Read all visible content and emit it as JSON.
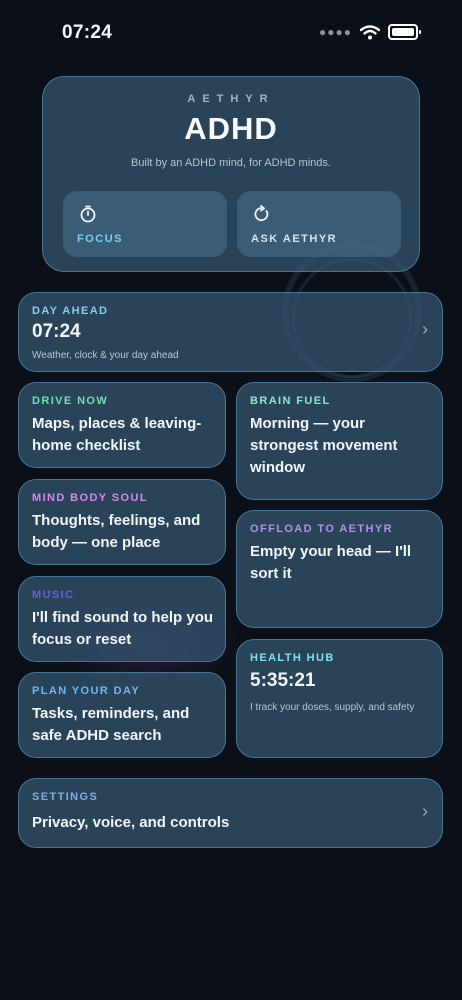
{
  "status_bar": {
    "time": "07:24"
  },
  "hero": {
    "brand": "AETHYR",
    "title": "ADHD",
    "subtitle": "Built by an ADHD mind, for ADHD minds.",
    "focus_label": "FOCUS",
    "ask_label": "ASK AETHYR",
    "focus_icon": "stopwatch-icon",
    "ask_icon": "refresh-icon"
  },
  "cards": {
    "day_ahead": {
      "label": "DAY AHEAD",
      "value": "07:24",
      "desc": "Weather, clock & your day ahead",
      "color": "#7fd3ea"
    },
    "drive_now": {
      "label": "DRIVE NOW",
      "text": "Maps, places & leaving-home checklist",
      "color": "#6fe0b0"
    },
    "brain_fuel": {
      "label": "BRAIN FUEL",
      "text": "Morning — your strongest movement window",
      "color": "#8ae8c8"
    },
    "mind_body_soul": {
      "label": "MIND BODY SOUL",
      "text": "Thoughts, feelings, and body — one place",
      "color": "#d58ae8"
    },
    "offload": {
      "label": "OFFLOAD TO AETHYR",
      "text": "Empty your head — I'll sort it",
      "color": "#b58cf0"
    },
    "music": {
      "label": "MUSIC",
      "text": "I'll find sound to help you focus or reset",
      "color": "#6a5ae0"
    },
    "health_hub": {
      "label": "HEALTH HUB",
      "value": "5:35:21",
      "desc": "I track your doses, supply, and safety",
      "color": "#7fe3e8"
    },
    "plan_day": {
      "label": "PLAN YOUR DAY",
      "text": "Tasks, reminders, and safe ADHD search",
      "color": "#6fb8f0"
    },
    "settings": {
      "label": "SETTINGS",
      "text": "Privacy, voice, and controls",
      "color": "#7fb0e8"
    }
  },
  "colors": {
    "accent_focus": "#7ad0f0",
    "accent_ask": "#d6e2ec",
    "background": "#0b0f17"
  }
}
